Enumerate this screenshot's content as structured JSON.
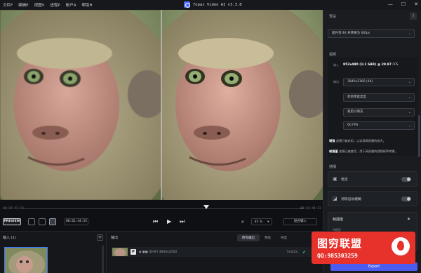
{
  "menu": {
    "items": [
      "文件F",
      "编辑E",
      "视图V",
      "进程P",
      "帐户A",
      "帮助H"
    ]
  },
  "app": {
    "title": "Topaz Video AI   v3.3.8"
  },
  "controls": {
    "preview_label": "PREVIEW",
    "current_time": "00:01:44:33",
    "zoom": "45 %",
    "fit_label": "贴合输入"
  },
  "timeline": {
    "start_time": "00:01:43:23",
    "end_time": "00:01:44:33"
  },
  "input_panel": {
    "title": "输入 (1)",
    "add_label": "+"
  },
  "output_panel": {
    "title": "输出",
    "tabs": [
      "所有输出",
      "预览",
      "导出"
    ],
    "active_tab": 0,
    "row": {
      "badge": "P",
      "info": "◆ ●● (DHF)   3840x2160",
      "duration": "1m22s"
    }
  },
  "sidebar": {
    "preset_title": "预设",
    "preset_value": "提升到 4K 并转换为 60fps",
    "video_title": "视频",
    "input_label": "输入",
    "input_info_prefix": "852x480 (1:1 SAR) @",
    "input_fps": "29.97",
    "input_fps_unit": "FPS",
    "output_label": "输出",
    "output_resolution": "3840x2160 (4K)",
    "pixel_type": "原始像素类型",
    "crop_mode": "裁剪以填充",
    "fps": "60 FPS",
    "note_enhance_label": "增强",
    "note_enhance_text": "滤镜已被启用，以实现高质量的放大。",
    "note_fi_label": "帧插值",
    "note_fi_text": "滤镜已被激活，用于高质量的视频帧率转换。",
    "enhancements_title": "插播",
    "stabilize_label": "稳定",
    "motion_blur_label": "消除运动模糊",
    "fi_title": "帧插值",
    "fi_sub": "AI模型",
    "fi_model": "Chronos",
    "export_label": "Export"
  },
  "watermark": {
    "title": "图穷联盟",
    "qq": "QQ:985303259"
  }
}
